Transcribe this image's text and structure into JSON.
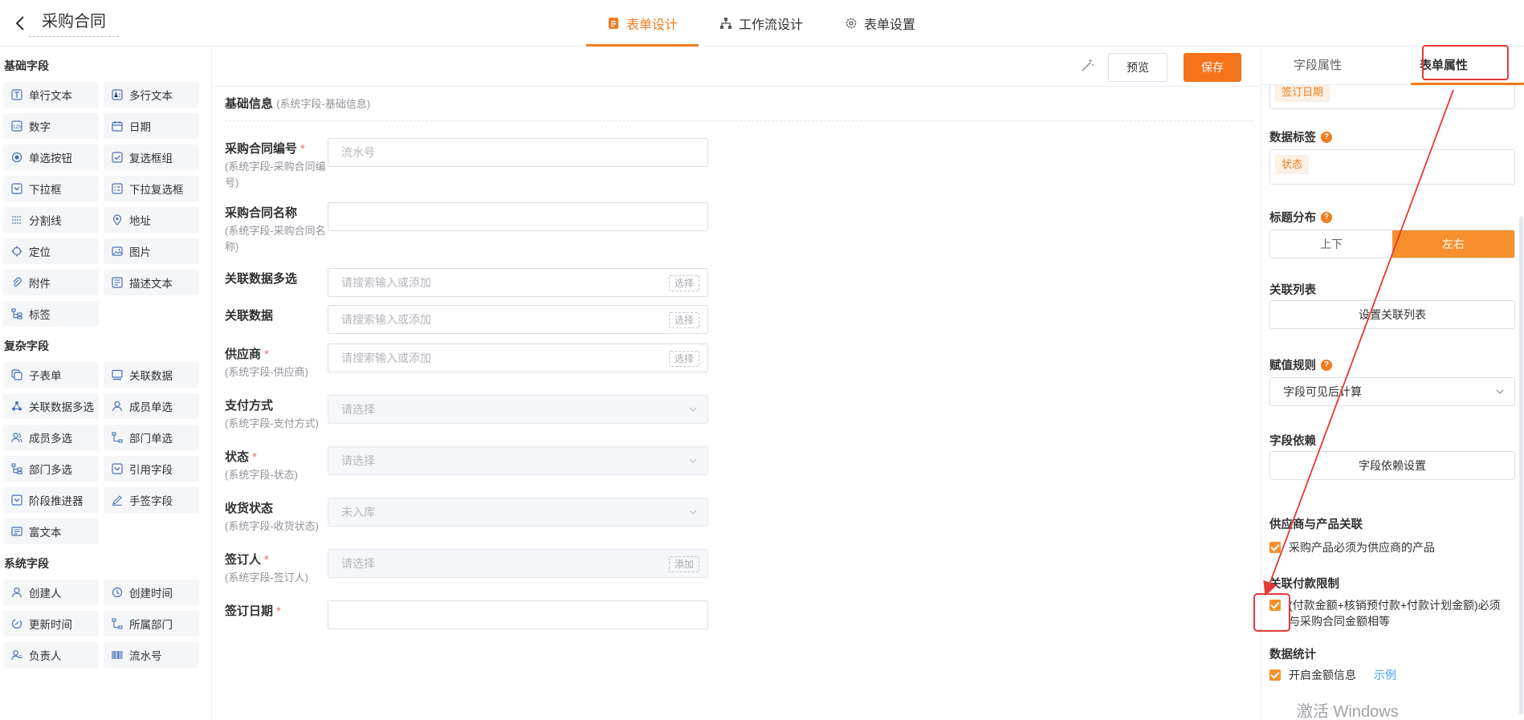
{
  "header": {
    "title": "采购合同",
    "tabs": [
      {
        "label": "表单设计",
        "active": true
      },
      {
        "label": "工作流设计",
        "active": false
      },
      {
        "label": "表单设置",
        "active": false
      }
    ]
  },
  "palette": {
    "groups": [
      {
        "title": "基础字段",
        "items": [
          {
            "label": "单行文本",
            "icon": "text-icon"
          },
          {
            "label": "多行文本",
            "icon": "textarea-icon"
          },
          {
            "label": "数字",
            "icon": "number-icon"
          },
          {
            "label": "日期",
            "icon": "calendar-icon"
          },
          {
            "label": "单选按钮",
            "icon": "radio-icon"
          },
          {
            "label": "复选框组",
            "icon": "checkbox-icon"
          },
          {
            "label": "下拉框",
            "icon": "dropdown-icon"
          },
          {
            "label": "下拉复选框",
            "icon": "dropdown-multi-icon"
          },
          {
            "label": "分割线",
            "icon": "divider-icon"
          },
          {
            "label": "地址",
            "icon": "location-pin-icon"
          },
          {
            "label": "定位",
            "icon": "crosshair-icon"
          },
          {
            "label": "图片",
            "icon": "image-icon"
          },
          {
            "label": "附件",
            "icon": "paperclip-icon"
          },
          {
            "label": "描述文本",
            "icon": "description-icon"
          },
          {
            "label": "标签",
            "icon": "tag-tree-icon"
          }
        ]
      },
      {
        "title": "复杂字段",
        "items": [
          {
            "label": "子表单",
            "icon": "subform-icon"
          },
          {
            "label": "关联数据",
            "icon": "link-data-icon"
          },
          {
            "label": "关联数据多选",
            "icon": "link-multi-icon"
          },
          {
            "label": "成员单选",
            "icon": "user-icon"
          },
          {
            "label": "成员多选",
            "icon": "users-icon"
          },
          {
            "label": "部门单选",
            "icon": "department-icon"
          },
          {
            "label": "部门多选",
            "icon": "department-multi-icon"
          },
          {
            "label": "引用字段",
            "icon": "reference-icon"
          },
          {
            "label": "阶段推进器",
            "icon": "stage-icon"
          },
          {
            "label": "手签字段",
            "icon": "signature-icon"
          },
          {
            "label": "富文本",
            "icon": "richtext-icon"
          }
        ]
      },
      {
        "title": "系统字段",
        "items": [
          {
            "label": "创建人",
            "icon": "user-icon"
          },
          {
            "label": "创建时间",
            "icon": "clock-icon"
          },
          {
            "label": "更新时间",
            "icon": "update-icon"
          },
          {
            "label": "所属部门",
            "icon": "department-icon"
          },
          {
            "label": "负责人",
            "icon": "owner-icon"
          },
          {
            "label": "流水号",
            "icon": "barcode-icon"
          }
        ]
      }
    ]
  },
  "toolbar": {
    "preview_label": "预览",
    "save_label": "保存"
  },
  "form": {
    "section_title": "基础信息",
    "section_sub": "(系统字段-基础信息)",
    "fields": [
      {
        "label": "采购合同编号",
        "required": true,
        "desc": "(系统字段-采购合同编号)",
        "placeholder": "流水号",
        "kind": "text"
      },
      {
        "label": "采购合同名称",
        "required": false,
        "desc": "(系统字段-采购合同名称)",
        "placeholder": "",
        "kind": "text"
      },
      {
        "label": "关联数据多选",
        "required": false,
        "desc": "",
        "placeholder": "请搜索输入或添加",
        "kind": "link",
        "action": "选择"
      },
      {
        "label": "关联数据",
        "required": false,
        "desc": "",
        "placeholder": "请搜索输入或添加",
        "kind": "link",
        "action": "选择"
      },
      {
        "label": "供应商",
        "required": true,
        "desc": "(系统字段-供应商)",
        "placeholder": "请搜索输入或添加",
        "kind": "link",
        "action": "选择"
      },
      {
        "label": "支付方式",
        "required": false,
        "desc": "(系统字段-支付方式)",
        "placeholder": "请选择",
        "kind": "select"
      },
      {
        "label": "状态",
        "required": true,
        "desc": "(系统字段-状态)",
        "placeholder": "请选择",
        "kind": "select"
      },
      {
        "label": "收货状态",
        "required": false,
        "desc": "(系统字段-收货状态)",
        "placeholder": "未入库",
        "kind": "select"
      },
      {
        "label": "签订人",
        "required": true,
        "desc": "(系统字段-签订人)",
        "placeholder": "请选择",
        "kind": "member",
        "action": "添加"
      },
      {
        "label": "签订日期",
        "required": true,
        "desc": "",
        "placeholder": "",
        "kind": "text"
      }
    ]
  },
  "props": {
    "tab_field": "字段属性",
    "tab_form": "表单属性",
    "top_tag": "签订日期",
    "data_label_title": "数据标签",
    "data_label_tag": "状态",
    "title_layout_title": "标题分布",
    "layout_options": [
      "上下",
      "左右"
    ],
    "layout_selected": "左右",
    "related_list_title": "关联列表",
    "related_list_button": "设置关联列表",
    "assign_rule_title": "赋值规则",
    "assign_rule_value": "字段可见后计算",
    "dependency_title": "字段依赖",
    "dependency_button": "字段依赖设置",
    "supplier_title": "供应商与产品关联",
    "supplier_check": "采购产品必须为供应商的产品",
    "payment_title": "关联付款限制",
    "payment_check": "(付款金额+核销预付款+付款计划金额)必须与采购合同金额相等",
    "stats_title": "数据统计",
    "stats_check": "开启金额信息",
    "stats_link": "示例"
  },
  "watermark": "激活 Windows",
  "colors": {
    "accent": "#f07c1f",
    "annotation": "#e53935",
    "link": "#409eff"
  }
}
